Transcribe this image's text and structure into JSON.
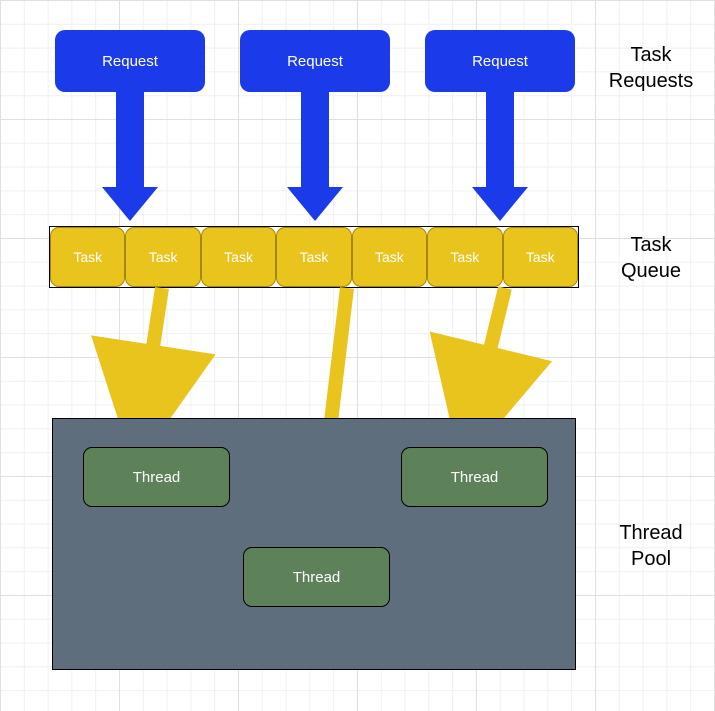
{
  "labels": {
    "task_requests": "Task\nRequests",
    "task_queue": "Task\nQueue",
    "thread_pool": "Thread\nPool"
  },
  "requests": [
    {
      "label": "Request"
    },
    {
      "label": "Request"
    },
    {
      "label": "Request"
    }
  ],
  "tasks": [
    {
      "label": "Task"
    },
    {
      "label": "Task"
    },
    {
      "label": "Task"
    },
    {
      "label": "Task"
    },
    {
      "label": "Task"
    },
    {
      "label": "Task"
    },
    {
      "label": "Task"
    }
  ],
  "threads": [
    {
      "label": "Thread"
    },
    {
      "label": "Thread"
    },
    {
      "label": "Thread"
    }
  ],
  "colors": {
    "request_blue": "#1b3bea",
    "task_yellow": "#e8c41c",
    "pool_gray": "#5e6e7d",
    "thread_green": "#5d8259"
  }
}
